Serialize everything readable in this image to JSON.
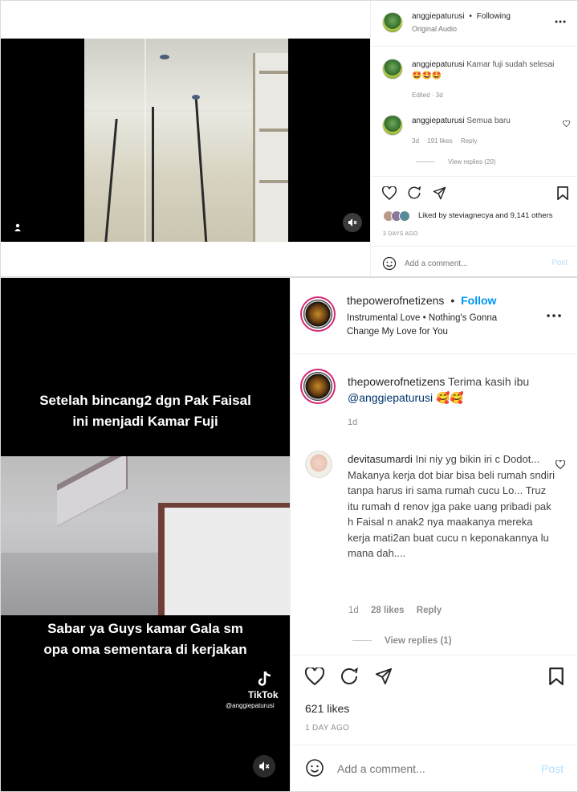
{
  "top_post": {
    "username": "anggiepaturusi",
    "dot": "•",
    "follow_status": "Following",
    "audio": "Original Audio",
    "comments": [
      {
        "username": "anggiepaturusi",
        "text": "Kamar fuji sudah selesai",
        "emoji": "🤩🤩🤩",
        "meta": "Edited · 3d"
      },
      {
        "username": "anggiepaturusi",
        "text": "Semua baru",
        "time": "3d",
        "likes": "191 likes",
        "reply": "Reply",
        "view_replies": "View replies (20)"
      }
    ],
    "liked_by_prefix": "Liked by",
    "liked_by_user": "steviagnecya",
    "liked_by_suffix": "and",
    "liked_by_others": "9,141 others",
    "time_ago": "3 DAYS AGO",
    "add_comment_placeholder": "Add a comment...",
    "post_label": "Post"
  },
  "bottom_post": {
    "username": "thepowerofnetizens",
    "dot": "•",
    "follow_label": "Follow",
    "audio": "Instrumental Love • Nothing's Gonna Change My Love for You",
    "video_caption_top": "Setelah bincang2 dgn Pak Faisal ini menjadi Kamar Fuji",
    "video_caption_bottom": "Sabar ya Guys kamar  Gala sm opa oma sementara di kerjakan",
    "tiktok_brand": "TikTok",
    "tiktok_handle": "@anggiepaturusi",
    "comments": [
      {
        "username": "thepowerofnetizens",
        "text": "Terima kasih ibu",
        "mention": "@anggiepaturusi",
        "emoji": "🥰🥰",
        "time": "1d"
      },
      {
        "username": "devitasumardi",
        "text": "Ini niy yg bikin iri c Dodot... Makanya kerja dot biar bisa beli rumah sndiri tanpa harus iri sama rumah cucu Lo... Truz itu rumah d renov jga pake uang pribadi pak h Faisal n anak2 nya maakanya mereka kerja mati2an buat cucu n keponakannya lu mana dah....",
        "time": "1d",
        "likes": "28 likes",
        "reply": "Reply",
        "view_replies": "View replies (1)"
      }
    ],
    "likes": "621 likes",
    "time_ago": "1 DAY AGO",
    "add_comment_placeholder": "Add a comment...",
    "post_label": "Post"
  },
  "colors": {
    "link": "#0095f6",
    "post_disabled": "#b2dffc",
    "text": "#262626",
    "muted": "#8e8e8e"
  }
}
